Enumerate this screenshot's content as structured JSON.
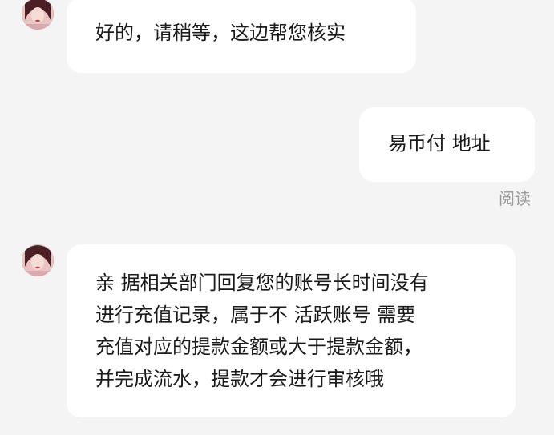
{
  "messages": [
    {
      "sender": "agent",
      "lines": [
        "好的，请稍等，这边帮您核实"
      ]
    },
    {
      "sender": "user",
      "lines": [
        "易币付 地址"
      ],
      "status": "阅读"
    },
    {
      "sender": "agent",
      "lines": [
        "亲 据相关部门回复您的账号长时间没有",
        "进行充值记录，属于不 活跃账号 需要",
        "充值对应的提款金额或大于提款金额，",
        "并完成流水，提款才会进行审核哦"
      ]
    }
  ],
  "colors": {
    "background": "#f4f4f4",
    "bubble": "#ffffff",
    "text": "#1a1a1a",
    "status": "#9a9a9a"
  }
}
